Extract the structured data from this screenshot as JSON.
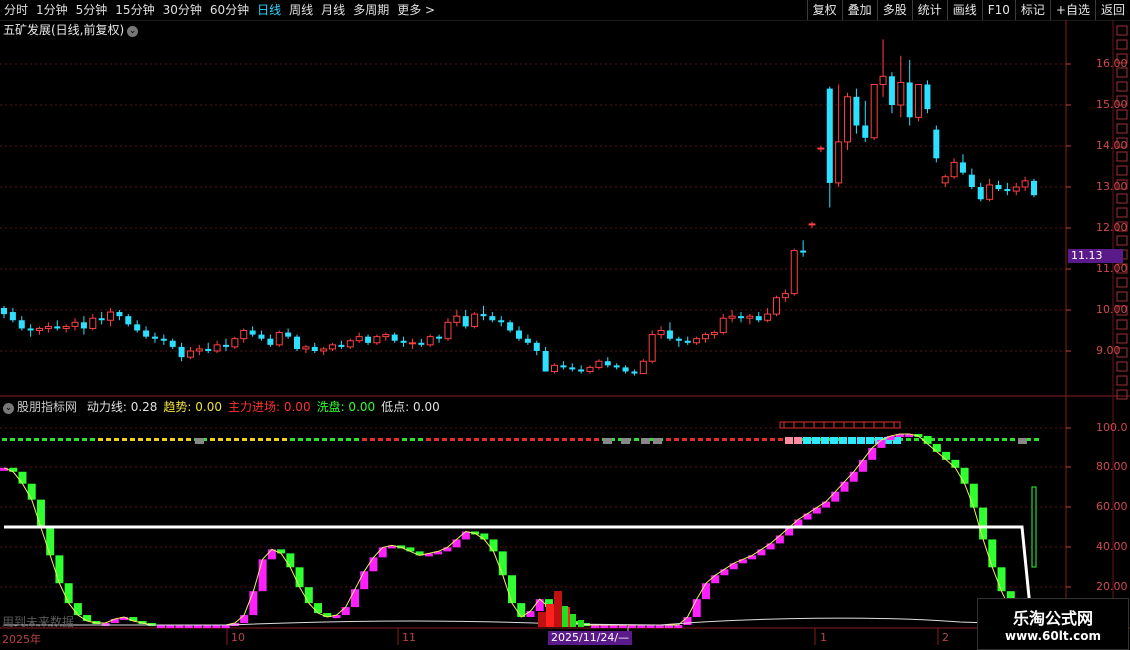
{
  "toolbar": {
    "periods": [
      "分时",
      "1分钟",
      "5分钟",
      "15分钟",
      "30分钟",
      "60分钟",
      "日线",
      "周线",
      "月线",
      "多周期",
      "更多 >"
    ],
    "active_period": "日线",
    "buttons": [
      "复权",
      "叠加",
      "多股",
      "统计",
      "画线",
      "F10",
      "标记",
      "+自选",
      "返回"
    ]
  },
  "main_chart": {
    "title": "五矿发展(日线,前复权)",
    "last_price_tag": "11.13",
    "y_labels": [
      "16.00",
      "15.00",
      "14.00",
      "13.00",
      "12.00",
      "11.00",
      "10.00",
      "9.00"
    ]
  },
  "indicator": {
    "name": "股朋指标网",
    "items": [
      {
        "label": "动力线:",
        "value": "0.28",
        "color": "#e0e0e0"
      },
      {
        "label": "趋势:",
        "value": "0.00",
        "color": "#f0e040"
      },
      {
        "label": "主力进场:",
        "value": "0.00",
        "color": "#ff3030"
      },
      {
        "label": "洗盘:",
        "value": "0.00",
        "color": "#30ff30"
      },
      {
        "label": "低点:",
        "value": "0.00",
        "color": "#e0e0e0"
      }
    ],
    "y_labels": [
      "100.0",
      "80.00",
      "60.00",
      "40.00",
      "20.00"
    ]
  },
  "x_axis": {
    "labels": [
      "2025年",
      "10",
      "11",
      "1",
      "2"
    ],
    "cursor_date": "2025/11/24/—"
  },
  "watermark": "用到未来数据",
  "logo": {
    "line1": "乐淘公式网",
    "line2": "www.60lt.com"
  },
  "colors": {
    "up": "#ff4040",
    "down": "#2ee0ff",
    "accent": "#2ad7ff",
    "magenta": "#ff20ff",
    "green": "#30ff30"
  },
  "chart_data": [
    {
      "type": "candlestick",
      "title": "五矿发展(日线,前复权)",
      "ylim": [
        8.3,
        16.7
      ],
      "ohlc": [
        [
          10.05,
          10.1,
          9.8,
          9.9
        ],
        [
          9.95,
          10.05,
          9.7,
          9.75
        ],
        [
          9.75,
          9.85,
          9.5,
          9.55
        ],
        [
          9.55,
          9.65,
          9.35,
          9.5
        ],
        [
          9.5,
          9.6,
          9.4,
          9.55
        ],
        [
          9.55,
          9.7,
          9.45,
          9.6
        ],
        [
          9.6,
          9.75,
          9.5,
          9.55
        ],
        [
          9.55,
          9.65,
          9.45,
          9.6
        ],
        [
          9.6,
          9.8,
          9.5,
          9.7
        ],
        [
          9.7,
          9.85,
          9.4,
          9.55
        ],
        [
          9.55,
          9.9,
          9.5,
          9.8
        ],
        [
          9.8,
          9.95,
          9.65,
          9.75
        ],
        [
          9.75,
          10.05,
          9.6,
          9.95
        ],
        [
          9.95,
          10.0,
          9.75,
          9.85
        ],
        [
          9.85,
          9.9,
          9.6,
          9.65
        ],
        [
          9.65,
          9.75,
          9.45,
          9.5
        ],
        [
          9.5,
          9.6,
          9.3,
          9.35
        ],
        [
          9.35,
          9.45,
          9.2,
          9.3
        ],
        [
          9.3,
          9.4,
          9.15,
          9.25
        ],
        [
          9.25,
          9.3,
          9.05,
          9.1
        ],
        [
          9.1,
          9.2,
          8.75,
          8.85
        ],
        [
          8.85,
          9.1,
          8.8,
          9.0
        ],
        [
          9.0,
          9.15,
          8.9,
          9.05
        ],
        [
          9.05,
          9.2,
          8.95,
          9.0
        ],
        [
          9.0,
          9.25,
          8.95,
          9.15
        ],
        [
          9.15,
          9.3,
          9.0,
          9.1
        ],
        [
          9.1,
          9.35,
          9.05,
          9.3
        ],
        [
          9.3,
          9.55,
          9.2,
          9.5
        ],
        [
          9.5,
          9.6,
          9.35,
          9.4
        ],
        [
          9.4,
          9.5,
          9.25,
          9.3
        ],
        [
          9.3,
          9.4,
          9.1,
          9.15
        ],
        [
          9.15,
          9.5,
          9.1,
          9.45
        ],
        [
          9.45,
          9.55,
          9.3,
          9.35
        ],
        [
          9.35,
          9.4,
          9.0,
          9.05
        ],
        [
          9.05,
          9.15,
          8.95,
          9.1
        ],
        [
          9.1,
          9.2,
          8.95,
          9.0
        ],
        [
          9.0,
          9.1,
          8.9,
          9.05
        ],
        [
          9.05,
          9.2,
          9.0,
          9.15
        ],
        [
          9.15,
          9.25,
          9.05,
          9.1
        ],
        [
          9.1,
          9.3,
          9.05,
          9.25
        ],
        [
          9.25,
          9.45,
          9.2,
          9.35
        ],
        [
          9.35,
          9.4,
          9.15,
          9.2
        ],
        [
          9.2,
          9.4,
          9.15,
          9.35
        ],
        [
          9.35,
          9.45,
          9.25,
          9.4
        ],
        [
          9.4,
          9.45,
          9.2,
          9.25
        ],
        [
          9.25,
          9.35,
          9.1,
          9.2
        ],
        [
          9.2,
          9.3,
          9.05,
          9.2
        ],
        [
          9.2,
          9.3,
          9.1,
          9.15
        ],
        [
          9.15,
          9.4,
          9.1,
          9.35
        ],
        [
          9.35,
          9.4,
          9.2,
          9.3
        ],
        [
          9.3,
          9.8,
          9.25,
          9.7
        ],
        [
          9.7,
          10.0,
          9.6,
          9.85
        ],
        [
          9.85,
          10.0,
          9.55,
          9.6
        ],
        [
          9.6,
          9.95,
          9.55,
          9.9
        ],
        [
          9.9,
          10.1,
          9.75,
          9.85
        ],
        [
          9.85,
          9.95,
          9.7,
          9.75
        ],
        [
          9.75,
          9.85,
          9.6,
          9.7
        ],
        [
          9.7,
          9.75,
          9.45,
          9.5
        ],
        [
          9.5,
          9.6,
          9.25,
          9.3
        ],
        [
          9.3,
          9.4,
          9.15,
          9.2
        ],
        [
          9.2,
          9.25,
          8.9,
          9.0
        ],
        [
          9.0,
          9.1,
          8.7,
          8.5
        ],
        [
          8.5,
          8.7,
          8.45,
          8.65
        ],
        [
          8.65,
          8.75,
          8.55,
          8.6
        ],
        [
          8.6,
          8.7,
          8.5,
          8.55
        ],
        [
          8.55,
          8.65,
          8.45,
          8.5
        ],
        [
          8.5,
          8.65,
          8.45,
          8.6
        ],
        [
          8.6,
          8.8,
          8.55,
          8.75
        ],
        [
          8.75,
          8.85,
          8.6,
          8.65
        ],
        [
          8.65,
          8.7,
          8.55,
          8.6
        ],
        [
          8.6,
          8.65,
          8.45,
          8.5
        ],
        [
          8.5,
          8.55,
          8.4,
          8.45
        ],
        [
          8.45,
          8.8,
          8.45,
          8.75
        ],
        [
          8.75,
          9.5,
          8.7,
          9.4
        ],
        [
          9.4,
          9.6,
          9.3,
          9.5
        ],
        [
          9.5,
          9.7,
          9.25,
          9.3
        ],
        [
          9.3,
          9.35,
          9.1,
          9.25
        ],
        [
          9.25,
          9.35,
          9.15,
          9.2
        ],
        [
          9.2,
          9.35,
          9.15,
          9.3
        ],
        [
          9.3,
          9.45,
          9.2,
          9.4
        ],
        [
          9.4,
          9.5,
          9.3,
          9.45
        ],
        [
          9.45,
          9.9,
          9.4,
          9.8
        ],
        [
          9.8,
          10.0,
          9.7,
          9.85
        ],
        [
          9.85,
          9.95,
          9.7,
          9.8
        ],
        [
          9.8,
          9.9,
          9.65,
          9.85
        ],
        [
          9.85,
          9.95,
          9.7,
          9.75
        ],
        [
          9.75,
          10.05,
          9.7,
          9.9
        ],
        [
          9.9,
          10.35,
          9.85,
          10.3
        ],
        [
          10.3,
          10.5,
          10.2,
          10.4
        ],
        [
          10.4,
          11.5,
          10.35,
          11.45
        ],
        [
          11.45,
          11.7,
          11.3,
          11.4
        ],
        [
          12.1,
          12.15,
          12.0,
          12.1
        ],
        [
          13.95,
          14.0,
          13.85,
          13.95
        ],
        [
          15.4,
          15.45,
          12.5,
          13.1
        ],
        [
          13.1,
          15.5,
          13.0,
          14.1
        ],
        [
          14.1,
          15.3,
          13.9,
          15.2
        ],
        [
          15.2,
          15.4,
          14.3,
          14.5
        ],
        [
          14.5,
          15.1,
          14.1,
          14.2
        ],
        [
          14.2,
          15.5,
          14.15,
          15.5
        ],
        [
          15.5,
          16.6,
          15.2,
          15.7
        ],
        [
          15.7,
          15.8,
          14.8,
          15.0
        ],
        [
          15.0,
          16.2,
          14.7,
          15.55
        ],
        [
          15.55,
          16.1,
          14.5,
          14.7
        ],
        [
          14.7,
          15.5,
          14.6,
          15.5
        ],
        [
          15.5,
          15.6,
          14.8,
          14.9
        ],
        [
          14.4,
          14.5,
          13.6,
          13.7
        ],
        [
          13.1,
          13.3,
          13.0,
          13.25
        ],
        [
          13.25,
          13.7,
          13.2,
          13.6
        ],
        [
          13.6,
          13.8,
          13.3,
          13.35
        ],
        [
          13.3,
          13.45,
          12.95,
          13.0
        ],
        [
          13.0,
          13.1,
          12.65,
          12.7
        ],
        [
          12.7,
          13.2,
          12.65,
          13.05
        ],
        [
          13.05,
          13.15,
          12.9,
          12.95
        ],
        [
          12.95,
          13.1,
          12.8,
          12.9
        ],
        [
          12.9,
          13.1,
          12.8,
          13.0
        ],
        [
          13.0,
          13.25,
          12.9,
          13.15
        ],
        [
          13.15,
          13.2,
          12.75,
          12.8
        ]
      ]
    },
    {
      "type": "bar",
      "title": "股朋指标网",
      "ylim": [
        0,
        110
      ],
      "reference_line": 50,
      "values": [
        80,
        78,
        72,
        64,
        50,
        36,
        22,
        12,
        6,
        3,
        2,
        2,
        4,
        5,
        3,
        2,
        1,
        1,
        1,
        1,
        1,
        1,
        1,
        1,
        1,
        2,
        6,
        18,
        34,
        39,
        37,
        30,
        20,
        12,
        7,
        5,
        6,
        10,
        19,
        28,
        35,
        40,
        41,
        40,
        38,
        36,
        37,
        38,
        40,
        44,
        48,
        47,
        44,
        38,
        26,
        12,
        5,
        8,
        14,
        10,
        6,
        3,
        2,
        1,
        1,
        1,
        1,
        1,
        1,
        1,
        1,
        1,
        1,
        1,
        5,
        14,
        22,
        26,
        29,
        32,
        34,
        36,
        39,
        42,
        46,
        50,
        54,
        57,
        60,
        63,
        68,
        73,
        78,
        84,
        90,
        94,
        96,
        97,
        97,
        96,
        92,
        88,
        84,
        80,
        72,
        60,
        44,
        30,
        18,
        8,
        4
      ],
      "signal_bars": [
        {
          "type": "red",
          "values": [
            9,
            15,
            18,
            10
          ]
        },
        {
          "type": "green",
          "values": [
            6,
            4,
            3
          ]
        }
      ]
    }
  ]
}
